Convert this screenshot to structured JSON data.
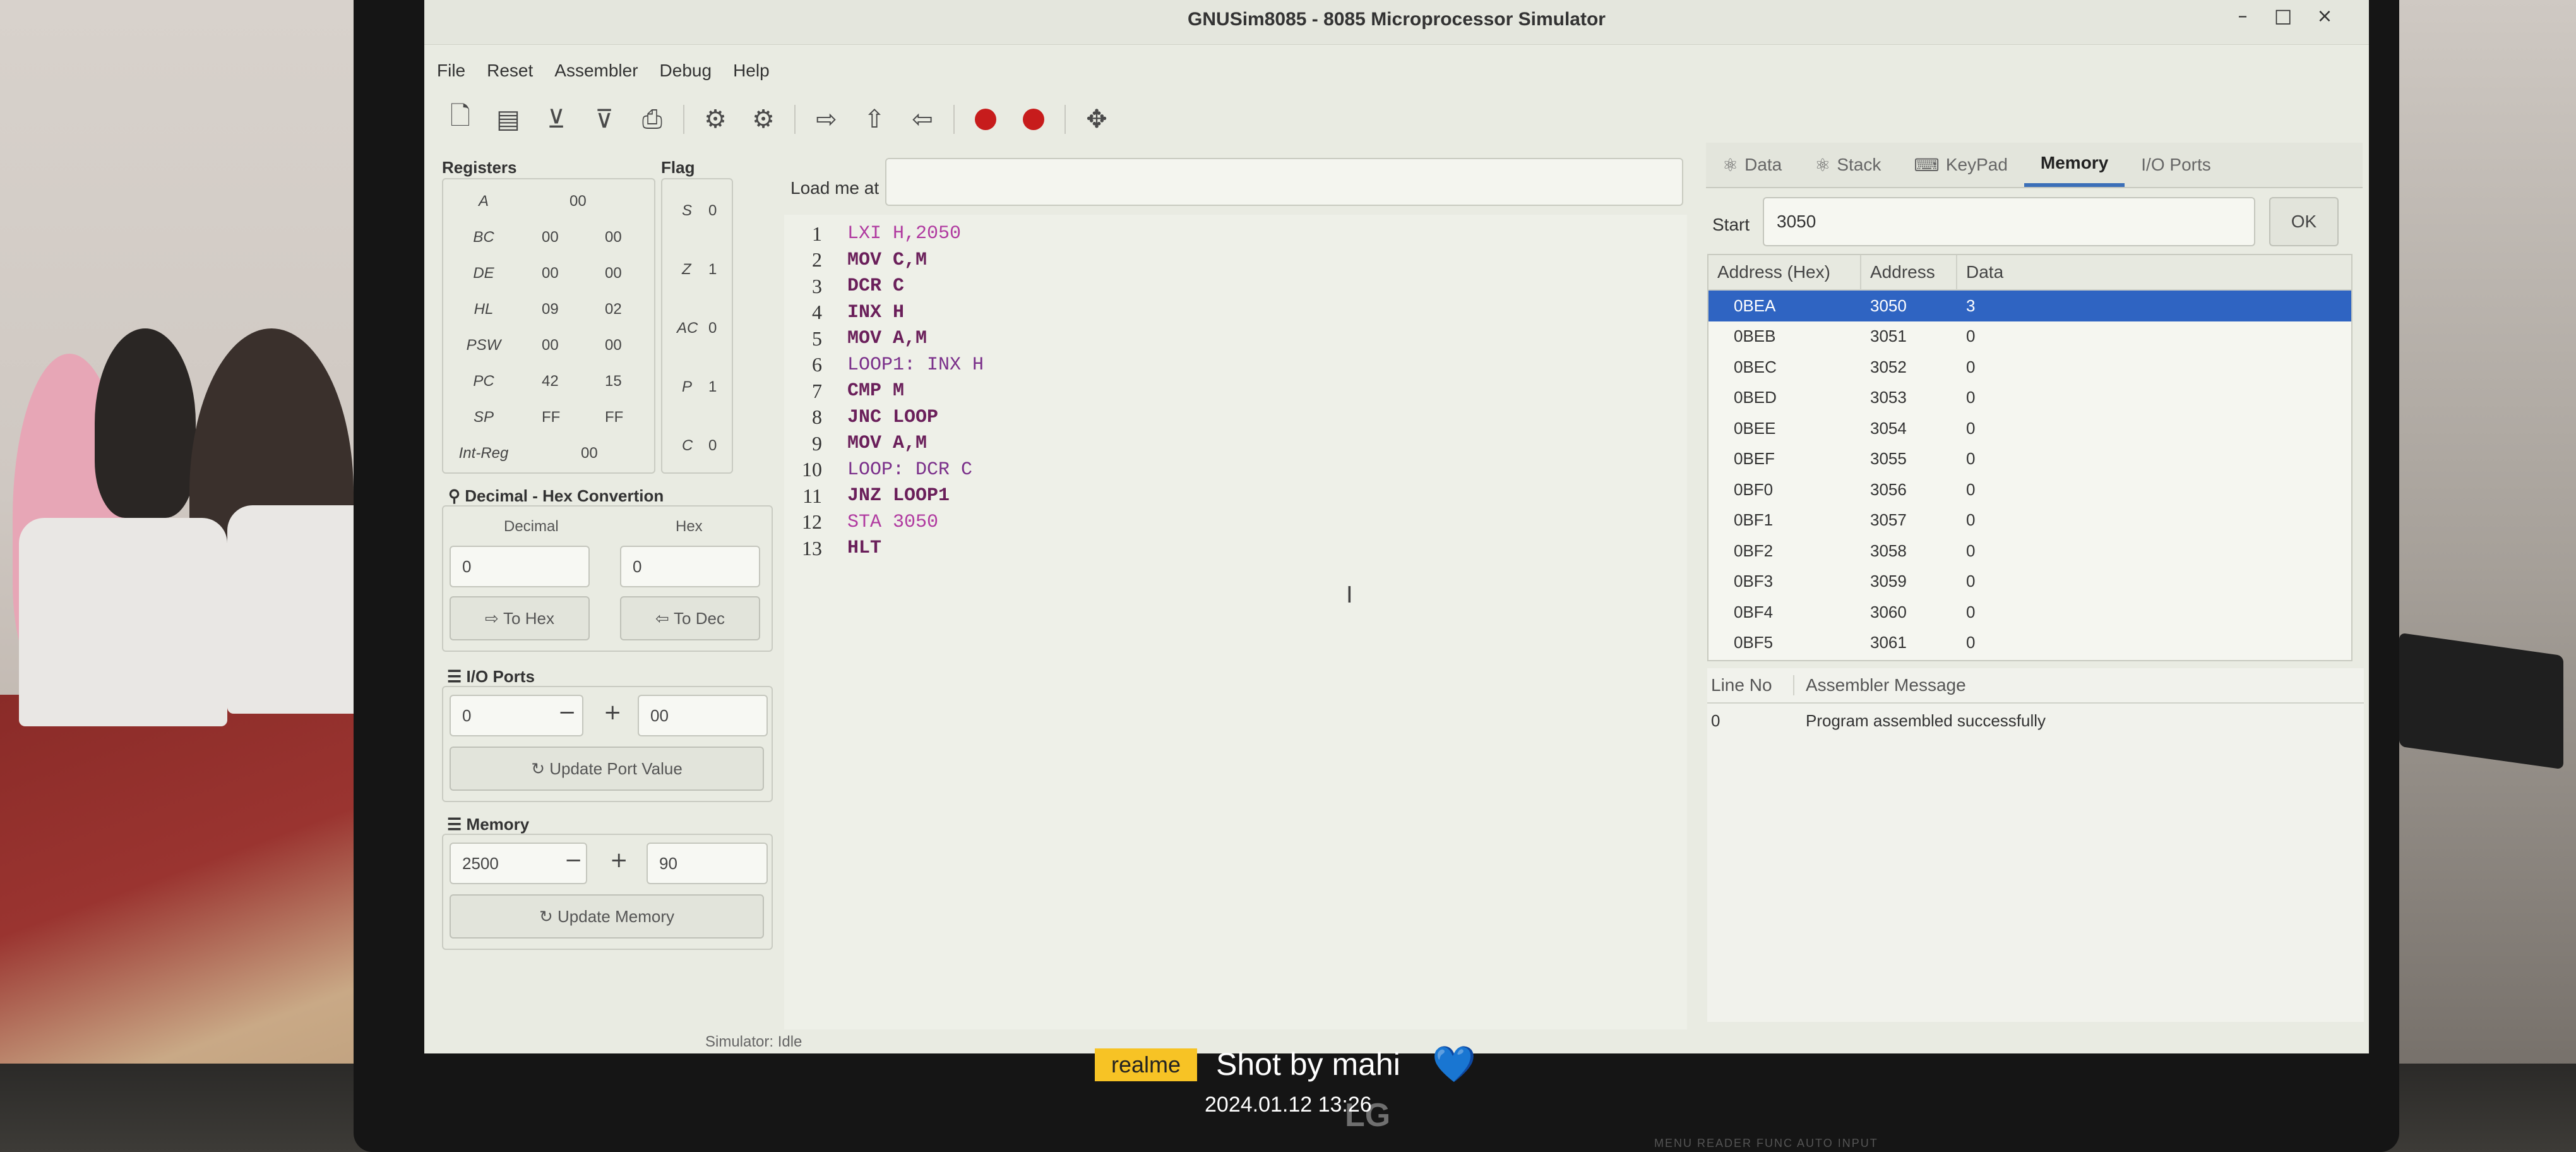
{
  "window": {
    "title": "GNUSim8085 - 8085 Microprocessor Simulator",
    "controls": [
      "–",
      "□",
      "×"
    ]
  },
  "menu": [
    "File",
    "Reset",
    "Assembler",
    "Debug",
    "Help"
  ],
  "toolbar_icons": [
    "new-file-icon",
    "open-file-icon",
    "save-icon",
    "save-as-icon",
    "print-icon",
    "assemble-icon",
    "assemble-execute-icon",
    "step-in-icon",
    "step-over-icon",
    "step-out-icon",
    "breakpoint-icon",
    "clear-breakpoints-icon",
    "stop-icon"
  ],
  "registers": {
    "label": "Registers",
    "rows": [
      {
        "name": "A",
        "v1": "00",
        "v2": ""
      },
      {
        "name": "BC",
        "v1": "00",
        "v2": "00"
      },
      {
        "name": "DE",
        "v1": "00",
        "v2": "00"
      },
      {
        "name": "HL",
        "v1": "09",
        "v2": "02"
      },
      {
        "name": "PSW",
        "v1": "00",
        "v2": "00"
      },
      {
        "name": "PC",
        "v1": "42",
        "v2": "15"
      },
      {
        "name": "SP",
        "v1": "FF",
        "v2": "FF"
      },
      {
        "name": "Int-Reg",
        "v1": "00",
        "v2": ""
      }
    ]
  },
  "flags": {
    "label": "Flag",
    "rows": [
      {
        "name": "S",
        "value": "0"
      },
      {
        "name": "Z",
        "value": "1"
      },
      {
        "name": "AC",
        "value": "0"
      },
      {
        "name": "P",
        "value": "1"
      },
      {
        "name": "C",
        "value": "0"
      }
    ]
  },
  "conversion": {
    "label": "Decimal - Hex Convertion",
    "decimal_label": "Decimal",
    "hex_label": "Hex",
    "decimal_value": "0",
    "hex_value": "0",
    "to_hex": "To Hex",
    "to_dec": "To Dec"
  },
  "io_ports": {
    "label": "I/O Ports",
    "port": "0",
    "value": "00",
    "update": "Update Port Value"
  },
  "memory_box": {
    "label": "Memory",
    "address": "2500",
    "value": "90",
    "update": "Update Memory"
  },
  "editor": {
    "load_label": "Load me at",
    "load_value": "",
    "lines": [
      {
        "n": "1",
        "text": "LXI H,2050"
      },
      {
        "n": "2",
        "text": "MOV C,M"
      },
      {
        "n": "3",
        "text": "DCR C"
      },
      {
        "n": "4",
        "text": "INX H"
      },
      {
        "n": "5",
        "text": "MOV A,M"
      },
      {
        "n": "6",
        "text": "LOOP1: INX H"
      },
      {
        "n": "7",
        "text": "CMP M"
      },
      {
        "n": "8",
        "text": "JNC LOOP"
      },
      {
        "n": "9",
        "text": "MOV A,M"
      },
      {
        "n": "10",
        "text": "LOOP: DCR C"
      },
      {
        "n": "11",
        "text": "JNZ LOOP1"
      },
      {
        "n": "12",
        "text": "STA 3050"
      },
      {
        "n": "13",
        "text": "HLT"
      }
    ]
  },
  "status": "Simulator: Idle",
  "tabs": [
    {
      "label": "Data",
      "icon": "data-icon",
      "active": false
    },
    {
      "label": "Stack",
      "icon": "stack-icon",
      "active": false
    },
    {
      "label": "KeyPad",
      "icon": "keypad-icon",
      "active": false
    },
    {
      "label": "Memory",
      "icon": "",
      "active": true
    },
    {
      "label": "I/O Ports",
      "icon": "",
      "active": false
    }
  ],
  "memory_view": {
    "start_label": "Start",
    "start_value": "3050",
    "ok": "OK",
    "headers": [
      "Address (Hex)",
      "Address",
      "Data"
    ],
    "rows": [
      [
        "0BEA",
        "3050",
        "3"
      ],
      [
        "0BEB",
        "3051",
        "0"
      ],
      [
        "0BEC",
        "3052",
        "0"
      ],
      [
        "0BED",
        "3053",
        "0"
      ],
      [
        "0BEE",
        "3054",
        "0"
      ],
      [
        "0BEF",
        "3055",
        "0"
      ],
      [
        "0BF0",
        "3056",
        "0"
      ],
      [
        "0BF1",
        "3057",
        "0"
      ],
      [
        "0BF2",
        "3058",
        "0"
      ],
      [
        "0BF3",
        "3059",
        "0"
      ],
      [
        "0BF4",
        "3060",
        "0"
      ],
      [
        "0BF5",
        "3061",
        "0"
      ]
    ]
  },
  "messages": {
    "headers": [
      "Line No",
      "Assembler Message"
    ],
    "rows": [
      [
        "0",
        "Program assembled successfully"
      ]
    ]
  },
  "watermark": {
    "brand": "realme",
    "text": "Shot by mahi",
    "heart": "💙",
    "date": "2024.01.12 13:26"
  },
  "monitor": {
    "logo": "LG",
    "buttons": "MENU  READER  FUNC  AUTO  INPUT"
  },
  "colors": {
    "selected_row": "#2f64c2",
    "breakpoint_red": "#c71c1c",
    "active_tab_underline": "#3b6fb8",
    "watermark_badge": "#f7c325"
  }
}
